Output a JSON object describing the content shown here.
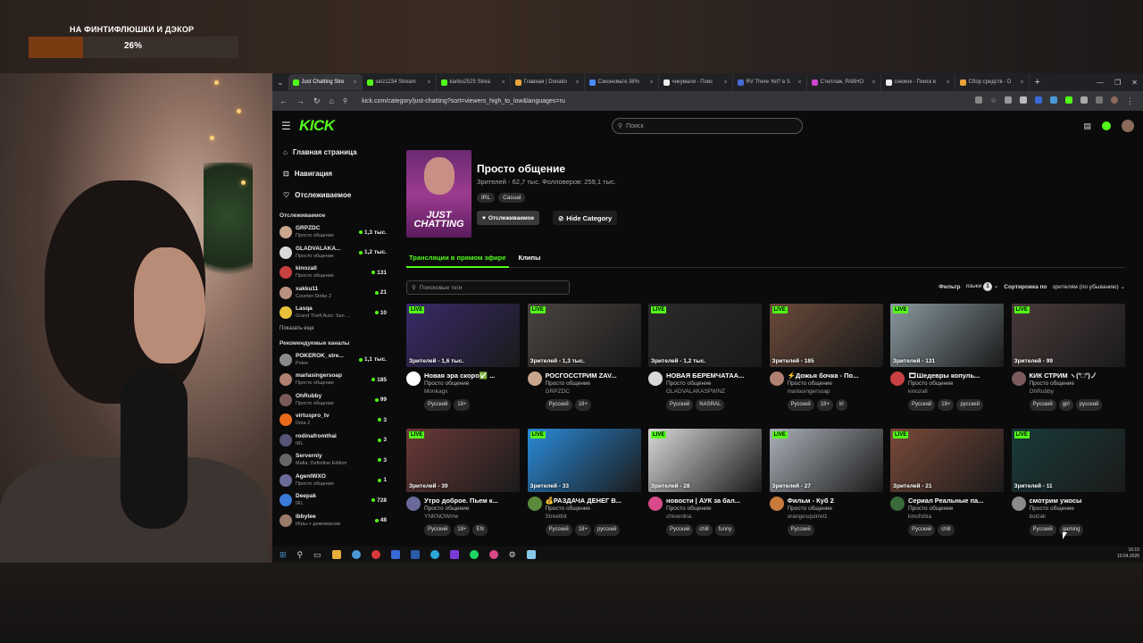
{
  "overlay": {
    "goal_title": "НА ФИНТИФЛЮШКИ И ДЭКОР",
    "goal_percent_text": "26%",
    "goal_percent": 26
  },
  "browser": {
    "tabs": [
      {
        "label": "Just Chatting Stre",
        "color": "#53fc18"
      },
      {
        "label": "seiz1234 Stream",
        "color": "#53fc18"
      },
      {
        "label": "kariko2525 Strea",
        "color": "#53fc18"
      },
      {
        "label": "Главная | Donatio",
        "color": "#e8a33a"
      },
      {
        "label": "Сэкономьте 38%",
        "color": "#4a8cff"
      },
      {
        "label": "чикумали - Поис",
        "color": "#eeeeee"
      },
      {
        "label": "RV There Yet? в S",
        "color": "#4a6ad8"
      },
      {
        "label": "Стеллаж, РАВНО",
        "color": "#cc44cc"
      },
      {
        "label": "снежок - Поиск в",
        "color": "#eeeeee"
      },
      {
        "label": "Сбор средств - D",
        "color": "#e8a33a"
      }
    ],
    "new_tab": "+",
    "url": "kick.com/category/just-chatting?sort=viewers_high_to_low&languages=ru"
  },
  "header": {
    "logo": "KICK",
    "search_placeholder": "Поиск"
  },
  "sidebar": {
    "nav": [
      {
        "icon": "home-icon",
        "glyph": "⌂",
        "label": "Главная страница"
      },
      {
        "icon": "compass-icon",
        "glyph": "⊡",
        "label": "Навигация"
      },
      {
        "icon": "heart-icon",
        "glyph": "♡",
        "label": "Отслеживаемое"
      }
    ],
    "following_title": "Отслеживаемое",
    "following": [
      {
        "name": "GRPZDC",
        "category": "Просто общение",
        "viewers": "1,3 тыс.",
        "color": "#c9a58b"
      },
      {
        "name": "GLADVALAKA...",
        "category": "Просто общение",
        "viewers": "1,2 тыс.",
        "color": "#d9d9d9"
      },
      {
        "name": "kinozall",
        "category": "Просто общение",
        "viewers": "131",
        "color": "#c84040"
      },
      {
        "name": "xakku11",
        "category": "Counter-Strike 2",
        "viewers": "21",
        "color": "#bb9080"
      },
      {
        "name": "Lasqa",
        "category": "Grand Theft Auto: San ...",
        "viewers": "10",
        "color": "#e8c03a"
      }
    ],
    "show_more": "Показать еще",
    "recommended_title": "Рекомендуемые каналы",
    "recommended": [
      {
        "name": "POKEROK_stre...",
        "category": "Poker",
        "viewers": "1,1 тыс.",
        "color": "#8a8a8a"
      },
      {
        "name": "marlasingersoap",
        "category": "Просто общение",
        "viewers": "185",
        "color": "#b08070"
      },
      {
        "name": "OhRubby",
        "category": "Просто общение",
        "viewers": "99",
        "color": "#7a5a5a"
      },
      {
        "name": "virtuspro_tv",
        "category": "Dota 2",
        "viewers": "3",
        "color": "#e86a1a"
      },
      {
        "name": "rodinafromthai",
        "category": "IRL",
        "viewers": "3",
        "color": "#555577"
      },
      {
        "name": "Serverniy",
        "category": "Mafia: Definitive Edition",
        "viewers": "3",
        "color": "#666666"
      },
      {
        "name": "AgentWXO",
        "category": "Просто общение",
        "viewers": "1",
        "color": "#6a6a9a"
      },
      {
        "name": "Deepak",
        "category": "IRL",
        "viewers": "728",
        "color": "#3a7ad8"
      },
      {
        "name": "ibbytee",
        "category": "Игры + демоверсии",
        "viewers": "48",
        "color": "#9a7a6a"
      }
    ]
  },
  "category": {
    "cover_text": "JUST CHATTING",
    "title": "Просто общение",
    "stats": "Зрителей - 62,7 тыс.  Фолловеров: 259,1 тыс.",
    "tags": [
      "IRL",
      "Casual"
    ],
    "follow_button": "Отслеживаемое",
    "hide_button": "Hide Category"
  },
  "content_tabs": [
    "Трансляции в прямом эфире",
    "Клипы"
  ],
  "tag_search_placeholder": "Поисковые теги",
  "filters": {
    "filter": "Фильтр",
    "languages": "языки",
    "languages_count": "1",
    "sort_by": "Сортировка по",
    "sort_value": "зрителям (по убыванию)"
  },
  "live_badge": "LIVE",
  "streams": [
    {
      "viewers": "Зрителей - 1,6 тыс.",
      "title": "Новая эра скоро✅ ...",
      "category": "Просто общение",
      "channel": "Monkagx",
      "tags": [
        "Русский",
        "18+"
      ],
      "thumb": "#3a2a6a",
      "av": "#ffffff"
    },
    {
      "viewers": "Зрителей - 1,3 тыс.",
      "title": "РОСГОССТРИМ ZAV...",
      "category": "Просто общение",
      "channel": "GRPZDC",
      "tags": [
        "Русский",
        "18+"
      ],
      "thumb": "#4a4440",
      "av": "#c9a58b"
    },
    {
      "viewers": "Зрителей - 1,2 тыс.",
      "title": "НОВАЯ БЕРЕМЧАТАА...",
      "category": "Просто общение",
      "channel": "GLADVALAKASPWNZ",
      "tags": [
        "Русский",
        "NASRAL"
      ],
      "thumb": "#2a2a2a",
      "av": "#d9d9d9"
    },
    {
      "viewers": "Зрителей - 185",
      "title": "⚡Дожья бочка - По...",
      "category": "Просто общение",
      "channel": "marlasingersoap",
      "tags": [
        "Русский",
        "18+",
        "irl"
      ],
      "thumb": "#6a4a3a",
      "av": "#b08070"
    },
    {
      "viewers": "Зрителей - 131",
      "title": "🎞Шедевры копуль...",
      "category": "Просто общение",
      "channel": "kinozall",
      "tags": [
        "Русский",
        "18+",
        "русский"
      ],
      "thumb": "#8a9aa0",
      "av": "#c84040"
    },
    {
      "viewers": "Зрителей - 99",
      "title": "КИК СТРИМ ヽ(°□°)ノ",
      "category": "Просто общение",
      "channel": "OhRubby",
      "tags": [
        "Русский",
        "girl",
        "русский"
      ],
      "thumb": "#4a3a3a",
      "av": "#7a5a5a"
    },
    {
      "viewers": "Зрителей - 39",
      "title": "Утро доброе. Пьем к...",
      "category": "Просто общение",
      "channel": "YNKNOWme",
      "tags": [
        "Русский",
        "18+",
        "EN"
      ],
      "thumb": "#6a3a38",
      "av": "#6a6a9a"
    },
    {
      "viewers": "Зрителей - 33",
      "title": "💰РАЗДАЧА ДЕНЕГ В...",
      "category": "Просто общение",
      "channel": "Streetbit",
      "tags": [
        "Русский",
        "18+",
        "русский"
      ],
      "thumb": "#2a8ad8",
      "av": "#5a8a3a"
    },
    {
      "viewers": "Зрителей - 28",
      "title": "новости | АУК за бал...",
      "category": "Просто общение",
      "channel": "chiverdna",
      "tags": [
        "Русский",
        "chill",
        "funny"
      ],
      "thumb": "#d8d8d8",
      "av": "#d84a8a"
    },
    {
      "viewers": "Зрителей - 27",
      "title": "Фильм - Куб 2",
      "category": "Просто общение",
      "channel": "orangesquirrel1",
      "tags": [
        "Русский"
      ],
      "thumb": "#aab0b8",
      "av": "#c87a3a"
    },
    {
      "viewers": "Зрителей - 21",
      "title": "Сериал Реальные па...",
      "category": "Просто общение",
      "channel": "kinofobia",
      "tags": [
        "Русский",
        "chill"
      ],
      "thumb": "#7a4a3a",
      "av": "#3a6a3a"
    },
    {
      "viewers": "Зрителей - 11",
      "title": "смотрим ужосы",
      "category": "Просто общение",
      "channel": "bolzak",
      "tags": [
        "Русский",
        "gaming"
      ],
      "thumb": "#1a3a3a",
      "av": "#8a8a8a"
    }
  ],
  "taskbar": {
    "time": "16:10",
    "date": "10.04.2026"
  }
}
